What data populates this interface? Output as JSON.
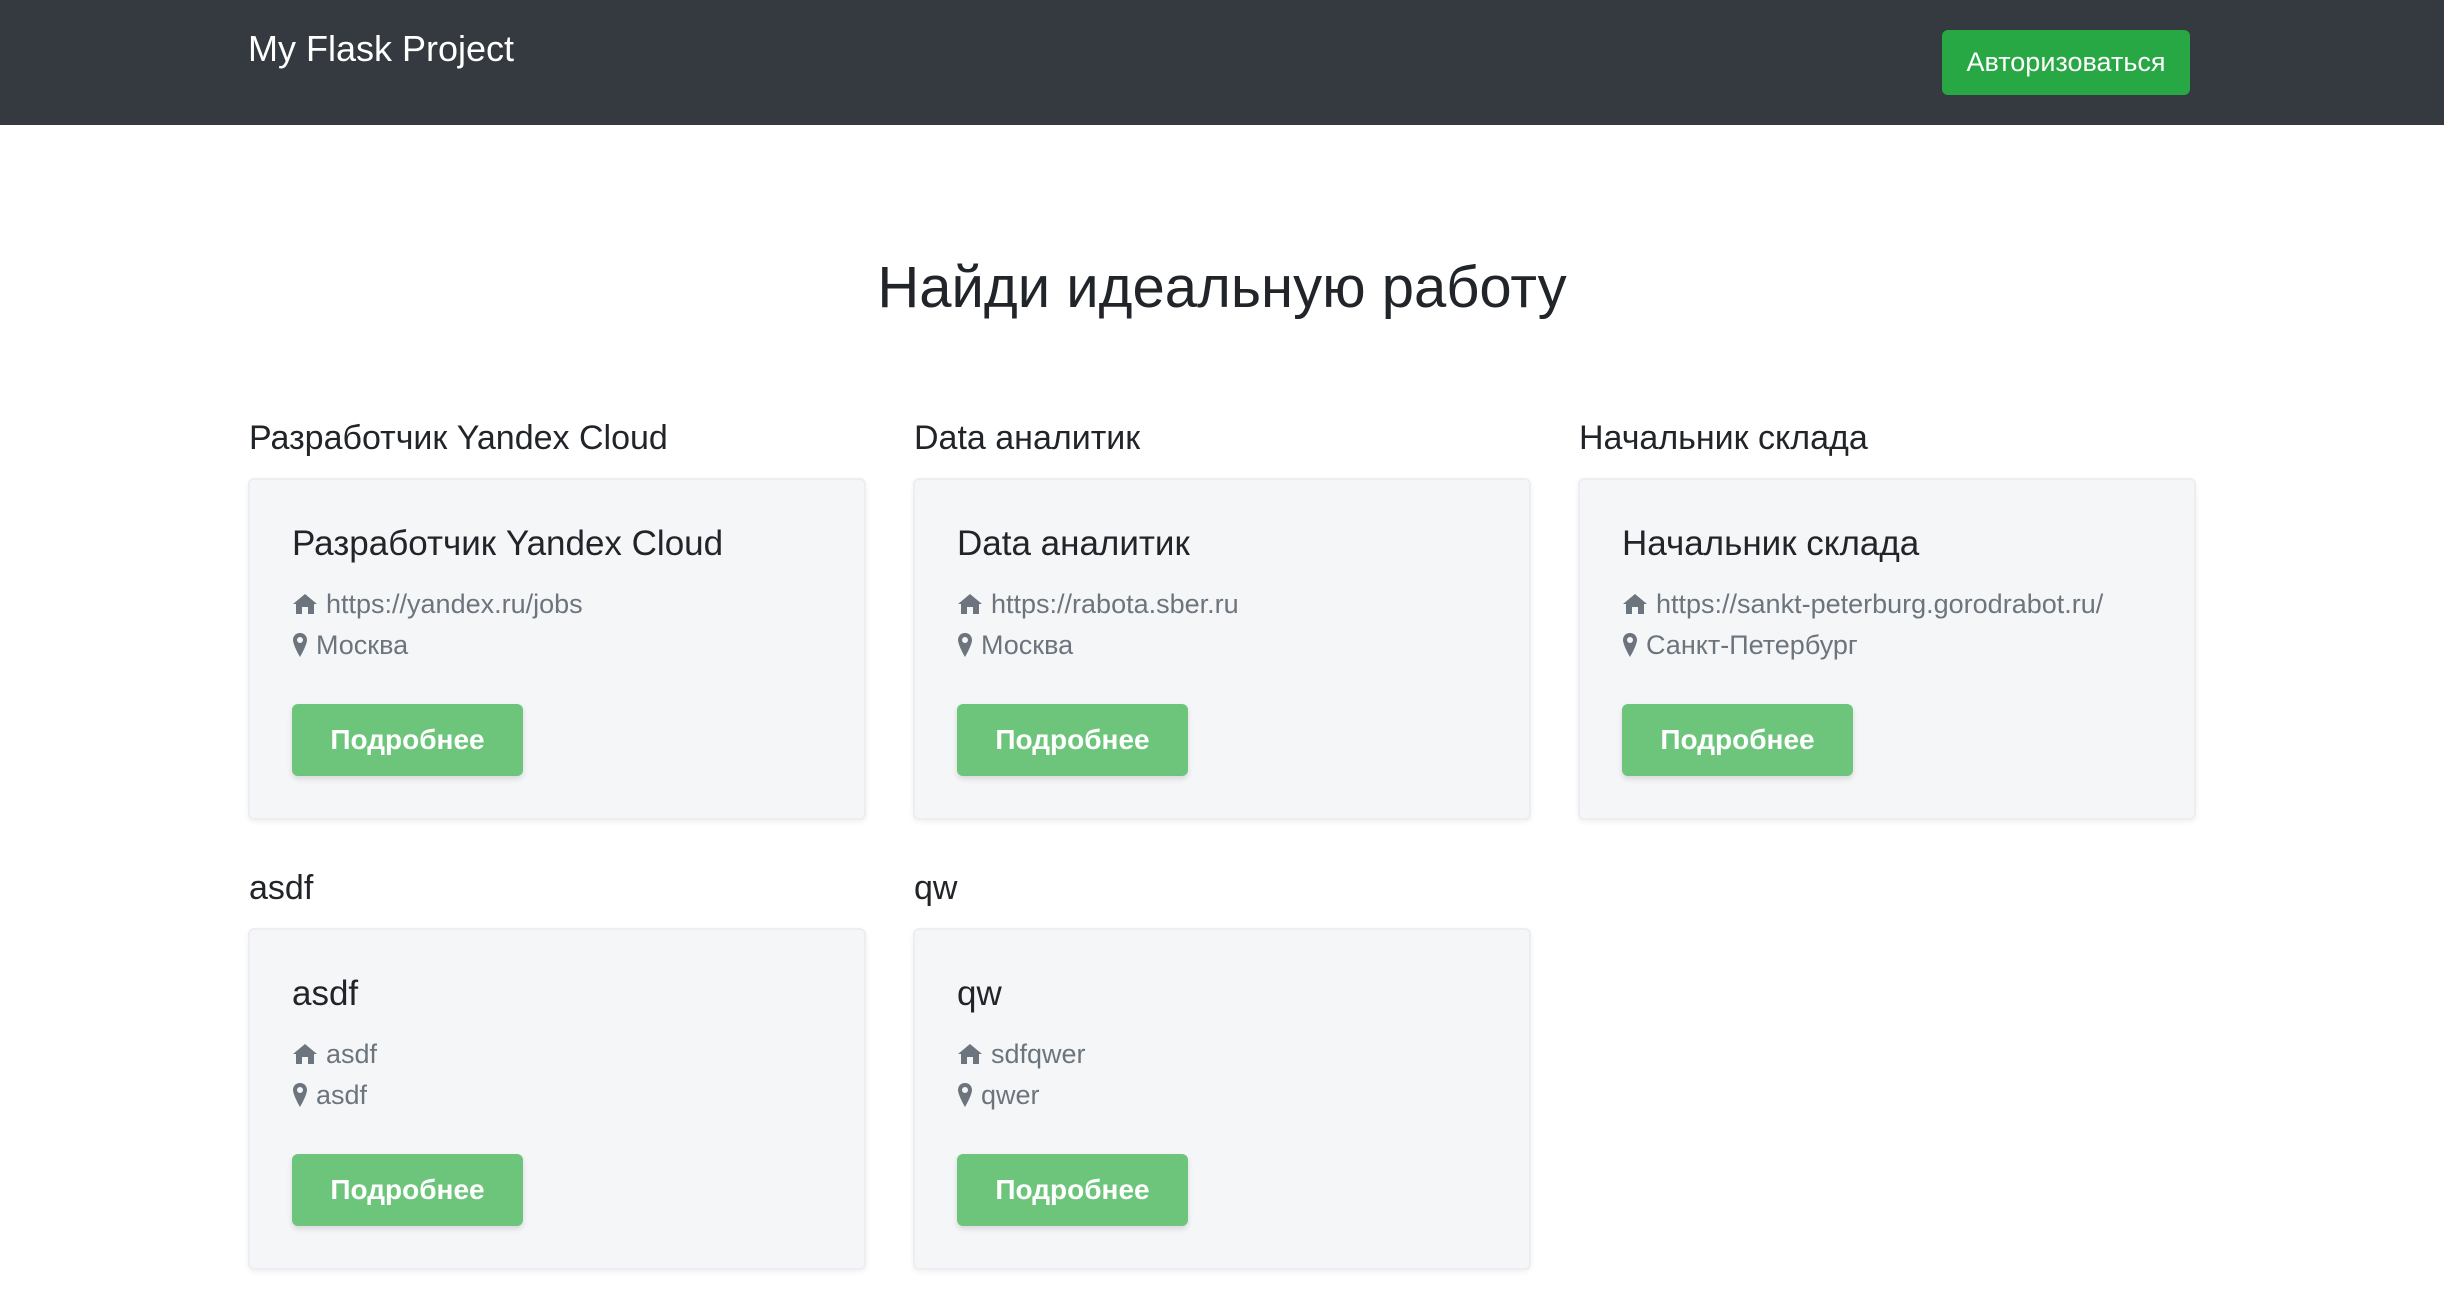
{
  "navbar": {
    "brand": "My Flask Project",
    "auth_label": "Авторизоваться"
  },
  "hero": {
    "title": "Найди идеальную работу"
  },
  "vacancies": [
    {
      "heading": "Разработчик Yandex Cloud",
      "title": "Разработчик Yandex Cloud",
      "link": "https://yandex.ru/jobs",
      "city": "Москва",
      "button": "Подробнее"
    },
    {
      "heading": "Data аналитик",
      "title": "Data аналитик",
      "link": "https://rabota.sber.ru",
      "city": "Москва",
      "button": "Подробнее"
    },
    {
      "heading": "Начальник склада",
      "title": "Начальник склада",
      "link": "https://sankt-peterburg.gorodrabot.ru/",
      "city": "Санкт-Петербург",
      "button": "Подробнее"
    },
    {
      "heading": "asdf",
      "title": "asdf",
      "link": "asdf",
      "city": "asdf",
      "button": "Подробнее"
    },
    {
      "heading": "qw",
      "title": "qw",
      "link": "sdfqwer",
      "city": "qwer",
      "button": "Подробнее"
    }
  ],
  "icons": {
    "link": "home-icon",
    "city": "map-marker-icon"
  },
  "colors": {
    "navbar_bg": "#343a40",
    "auth_button": "#28a745",
    "details_button": "#6cc57b",
    "card_bg": "#f5f6f8",
    "muted_text": "#6c757d"
  }
}
